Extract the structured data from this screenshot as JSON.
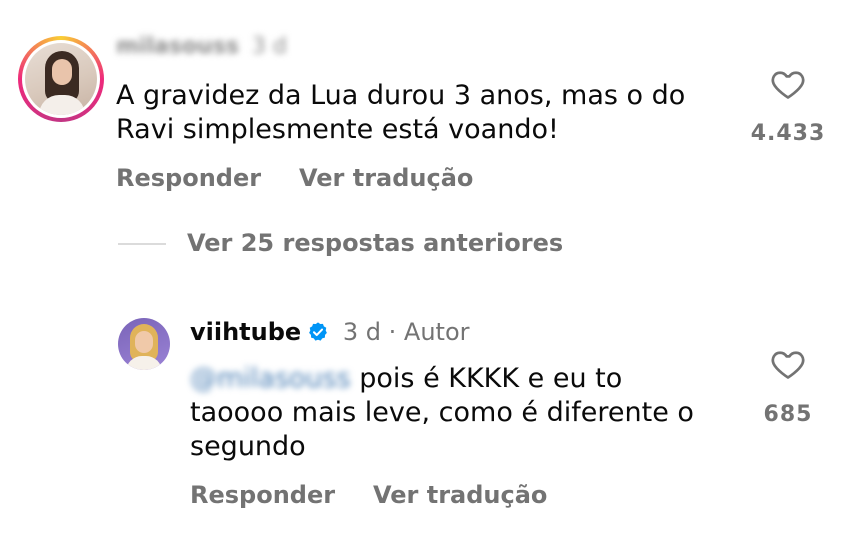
{
  "comment1": {
    "username": "milasouss",
    "time": "3 d",
    "text_line1": "A gravidez da Lua durou 3 anos, mas o do",
    "text_line2": "Ravi simplesmente está voando!",
    "likes": "4.433",
    "reply_label": "Responder",
    "translate_label": "Ver tradução"
  },
  "replies": {
    "view_previous_label": "Ver 25 respostas anteriores"
  },
  "comment2": {
    "username": "viihtube",
    "time": "3 d",
    "separator": "·",
    "author_badge": "Autor",
    "mention": "@milasouss",
    "text_line1": " pois é KKKK e eu to",
    "text_line2": "taoooo mais leve, como é diferente o",
    "text_line3": "segundo",
    "likes": "685",
    "reply_label": "Responder",
    "translate_label": "Ver tradução"
  },
  "colors": {
    "muted": "#737373",
    "verified_blue": "#0095f6",
    "divider": "#dbdbdb"
  },
  "icons": [
    "heart-icon",
    "verified-badge-icon"
  ]
}
